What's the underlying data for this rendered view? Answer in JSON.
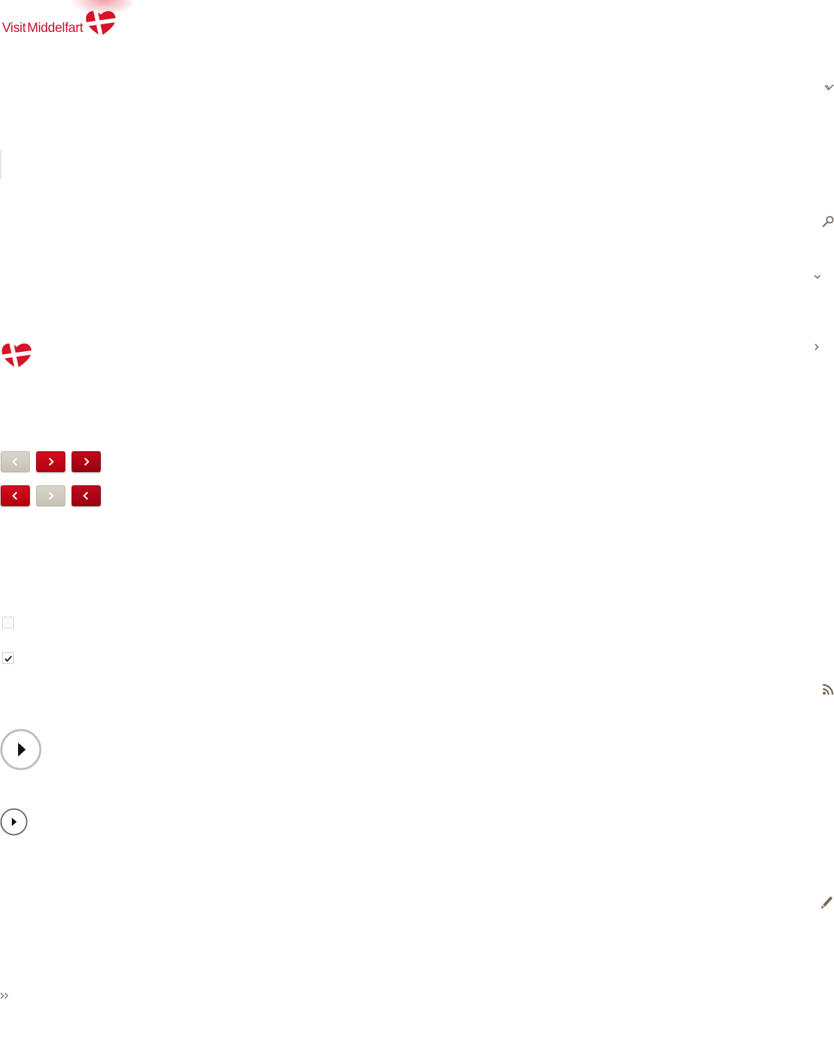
{
  "header": {
    "logo": {
      "word_visit": "Visit",
      "word_place": "Middelfart",
      "brand_color": "#c8102e"
    }
  },
  "icons": {
    "dropdown_chevron": "chevron-down-icon",
    "search": "search-icon",
    "caret_down": "caret-down-icon",
    "caret_right": "caret-right-icon",
    "rss": "rss-icon",
    "edit": "pencil-icon",
    "more": "double-chevron-right-icon"
  },
  "controls": {
    "carousel_row_1": [
      {
        "direction": "left",
        "state": "disabled"
      },
      {
        "direction": "right",
        "state": "normal"
      },
      {
        "direction": "right",
        "state": "hover"
      }
    ],
    "carousel_row_2": [
      {
        "direction": "left",
        "state": "normal"
      },
      {
        "direction": "right",
        "state": "disabled"
      },
      {
        "direction": "left",
        "state": "hover"
      }
    ],
    "checkboxes": [
      {
        "checked": false
      },
      {
        "checked": true
      }
    ],
    "play_buttons": [
      "play-large",
      "play-small"
    ]
  },
  "colors": {
    "accent_red": "#c8102e",
    "button_red": "#c30a1a",
    "button_disabled": "#d0cbbf",
    "icon_brown": "#7a6a5a"
  }
}
